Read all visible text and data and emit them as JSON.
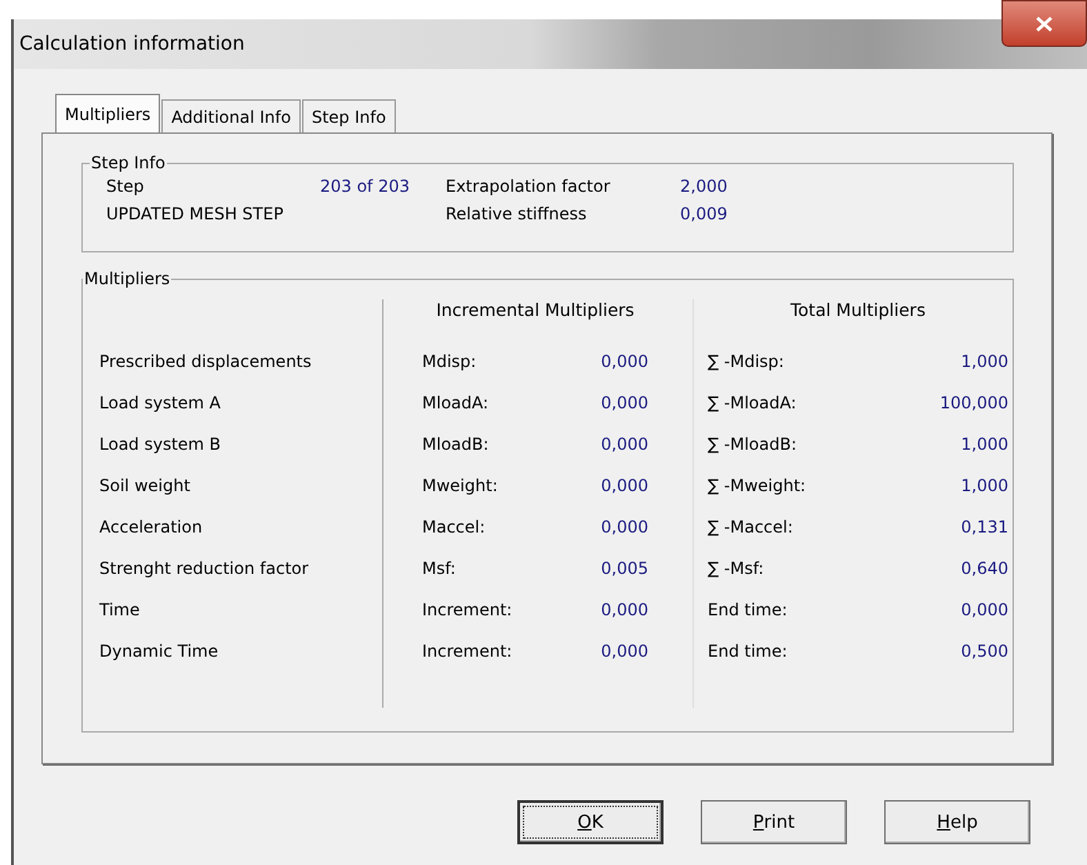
{
  "window": {
    "title": "Calculation information"
  },
  "tabs": [
    {
      "label": "Multipliers",
      "selected": true
    },
    {
      "label": "Additional Info",
      "selected": false
    },
    {
      "label": "Step Info",
      "selected": false
    }
  ],
  "step_info": {
    "title": "Step Info",
    "rows": [
      {
        "label": "Step",
        "value": "203 of 203",
        "label_2": "Extrapolation factor",
        "value_2": "2,000"
      },
      {
        "label": "UPDATED MESH STEP",
        "label_2": "Relative stiffness",
        "value_2": "0,009"
      }
    ]
  },
  "multipliers": {
    "title": "Multipliers",
    "incremental_heading": "Incremental Multipliers",
    "total_heading": "Total Multipliers",
    "rows": [
      {
        "name": "Prescribed displacements",
        "inc_label": "Mdisp:",
        "inc_value": "0,000",
        "total_label": "∑ -Mdisp:",
        "total_value": "1,000"
      },
      {
        "name": "Load system A",
        "inc_label": "MloadA:",
        "inc_value": "0,000",
        "total_label": "∑ -MloadA:",
        "total_value": "100,000"
      },
      {
        "name": "Load system B",
        "inc_label": "MloadB:",
        "inc_value": "0,000",
        "total_label": "∑ -MloadB:",
        "total_value": "1,000"
      },
      {
        "name": "Soil weight",
        "inc_label": "Mweight:",
        "inc_value": "0,000",
        "total_label": "∑ -Mweight:",
        "total_value": "1,000"
      },
      {
        "name": "Acceleration",
        "inc_label": "Maccel:",
        "inc_value": "0,000",
        "total_label": "∑ -Maccel:",
        "total_value": "0,131"
      },
      {
        "name": "Strenght reduction factor",
        "inc_label": "Msf:",
        "inc_value": "0,005",
        "total_label": "∑ -Msf:",
        "total_value": "0,640"
      },
      {
        "name": "Time",
        "inc_label": "Increment:",
        "inc_value": "0,000",
        "total_label": "End time:",
        "total_value": "0,000"
      },
      {
        "name": "Dynamic Time",
        "inc_label": "Increment:",
        "inc_value": "0,000",
        "total_label": "End time:",
        "total_value": "0,500"
      }
    ]
  },
  "buttons": [
    {
      "mnemonic": "O",
      "rest": "K",
      "focused": true
    },
    {
      "mnemonic": "P",
      "rest": "rint",
      "focused": false
    },
    {
      "mnemonic": "H",
      "rest": "elp",
      "focused": false
    }
  ]
}
